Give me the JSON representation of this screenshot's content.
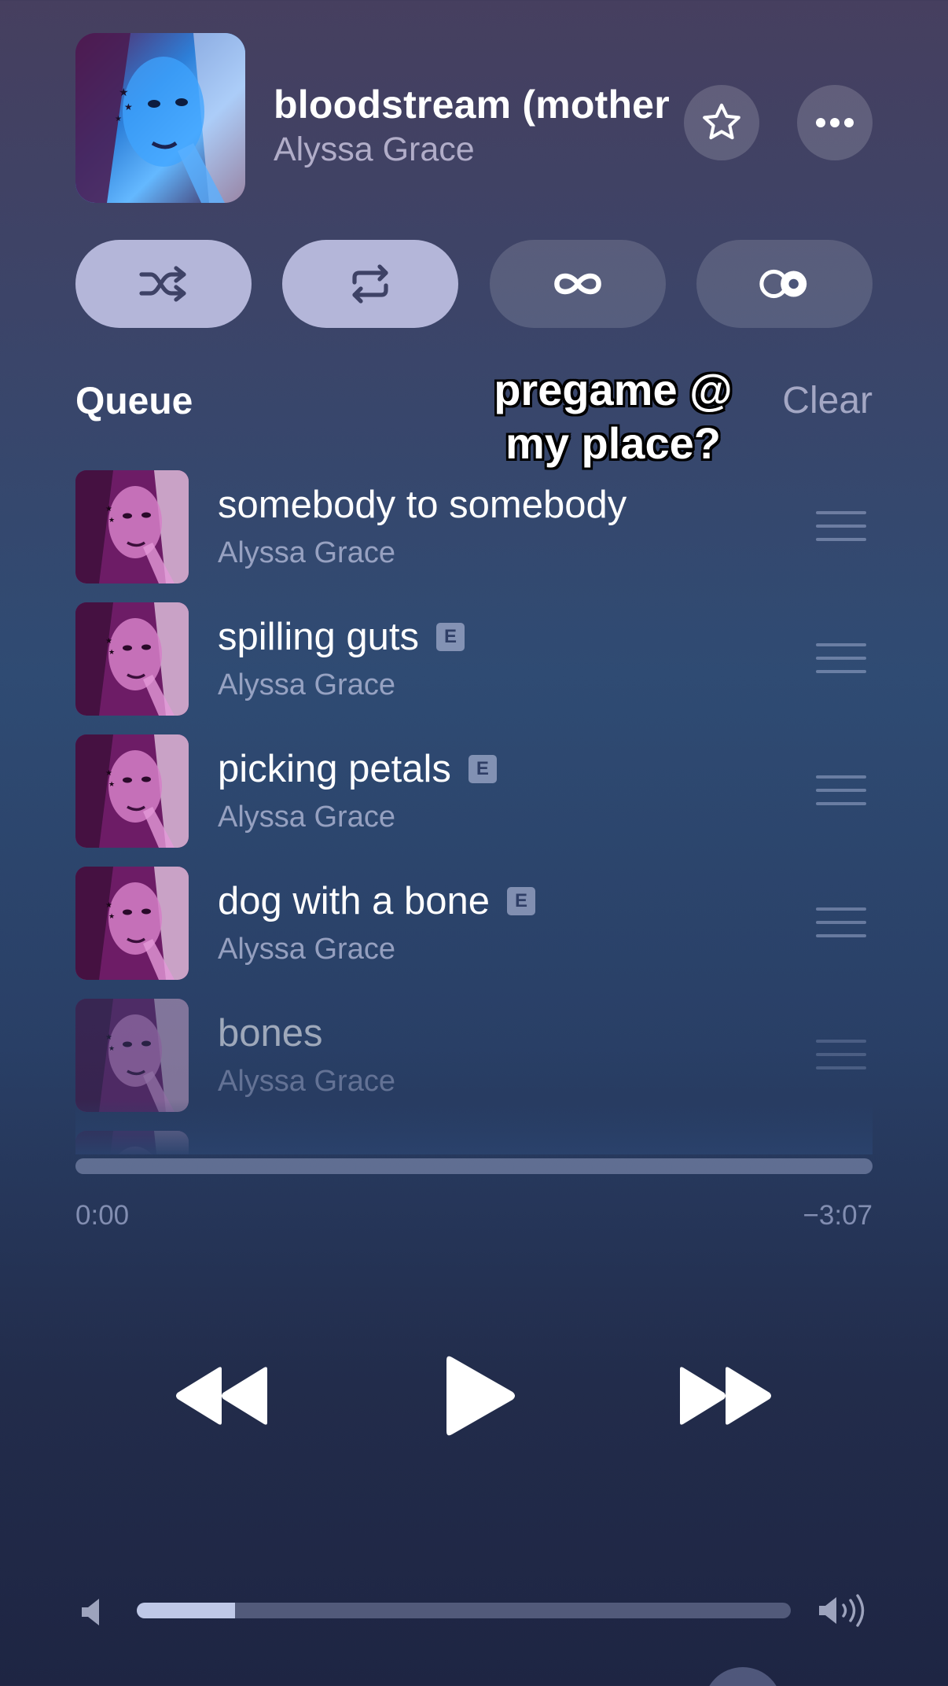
{
  "now_playing": {
    "title": "bloodstream (mother",
    "artist": "Alyssa Grace",
    "favorite_icon": "star-icon",
    "more_icon": "ellipsis-icon"
  },
  "modes": [
    {
      "icon": "shuffle-icon",
      "active": true
    },
    {
      "icon": "repeat-icon",
      "active": true
    },
    {
      "icon": "infinity-icon",
      "active": false
    },
    {
      "icon": "crossfade-icon",
      "active": false
    }
  ],
  "queue": {
    "label": "Queue",
    "clear_label": "Clear",
    "items": [
      {
        "title": "somebody to somebody",
        "artist": "Alyssa Grace",
        "explicit": false
      },
      {
        "title": "spilling guts",
        "artist": "Alyssa Grace",
        "explicit": true
      },
      {
        "title": "picking petals",
        "artist": "Alyssa Grace",
        "explicit": true
      },
      {
        "title": "dog with a bone",
        "artist": "Alyssa Grace",
        "explicit": true
      },
      {
        "title": "bones",
        "artist": "Alyssa Grace",
        "explicit": false
      }
    ],
    "explicit_badge": "E"
  },
  "overlay_caption": {
    "line1": "pregame @",
    "line2": "my place?"
  },
  "playback": {
    "elapsed": "0:00",
    "remaining": "−3:07",
    "progress_fraction": 0.0
  },
  "transport": {
    "previous_icon": "rewind-icon",
    "play_icon": "play-icon",
    "next_icon": "fast-forward-icon"
  },
  "volume": {
    "level_fraction": 0.15,
    "low_icon": "speaker-low-icon",
    "high_icon": "speaker-high-icon"
  },
  "colors": {
    "pill_active": "#b4b6d9",
    "pill_icon_active": "#3e4266"
  }
}
